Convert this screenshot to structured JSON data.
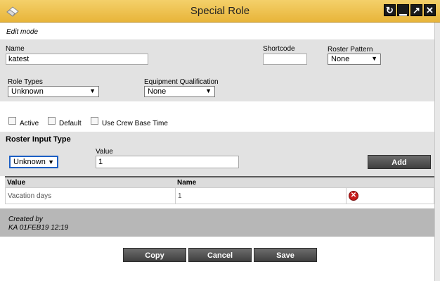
{
  "window": {
    "title": "Special Role"
  },
  "mode_label": "Edit mode",
  "form": {
    "name_label": "Name",
    "name_value": "katest",
    "shortcode_label": "Shortcode",
    "shortcode_value": "",
    "roster_pattern_label": "Roster Pattern",
    "roster_pattern_value": "None",
    "role_types_label": "Role Types",
    "role_types_value": "Unknown",
    "equipment_label": "Equipment Qualification",
    "equipment_value": "None"
  },
  "checkboxes": [
    {
      "label": "Active",
      "checked": false
    },
    {
      "label": "Default",
      "checked": false
    },
    {
      "label": "Use Crew Base Time",
      "checked": false
    }
  ],
  "roster_input": {
    "heading": "Roster Input Type",
    "type_value": "Unknown",
    "value_label": "Value",
    "value": "1",
    "add_label": "Add"
  },
  "table": {
    "headers": [
      "Value",
      "Name"
    ],
    "rows": [
      {
        "value": "Vacation days",
        "name": "1"
      }
    ]
  },
  "created": {
    "label": "Created by",
    "info": "KA 01FEB19 12:19"
  },
  "buttons": {
    "copy": "Copy",
    "cancel": "Cancel",
    "save": "Save"
  }
}
